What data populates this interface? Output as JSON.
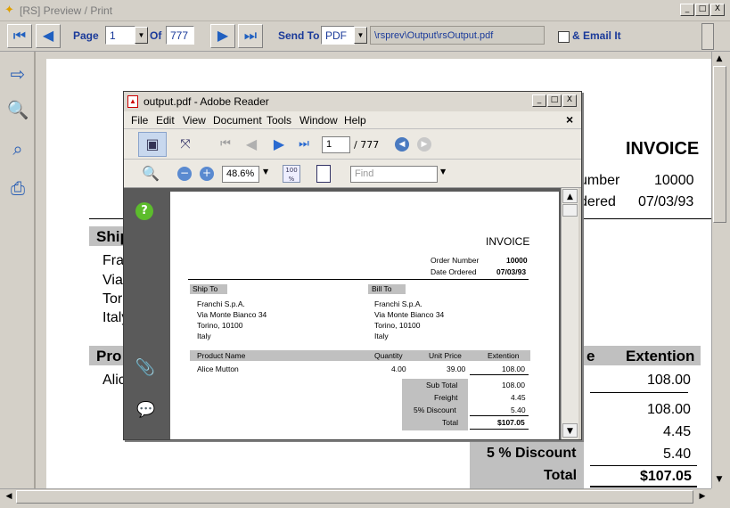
{
  "main_window": {
    "title": "[RS] Preview  / Print",
    "controls": {
      "minimize": "_",
      "maximize": "□",
      "close": "X"
    }
  },
  "toolbar": {
    "first_icon": "first-page-icon",
    "prev_icon": "prev-page-icon",
    "page_label": "Page",
    "page_value": "1",
    "of_label": "Of",
    "total_pages": "777",
    "next_icon": "next-page-icon",
    "last_icon": "last-page-icon",
    "send_to_label": "Send To",
    "send_to_value": "PDF",
    "output_path": "\\rsprev\\Output\\rsOutput.pdf",
    "email_label": "& Email It",
    "email_checked": false
  },
  "side_tools": [
    "export-icon",
    "zoom-icon",
    "find-page-icon",
    "print-icon"
  ],
  "background_invoice": {
    "title": "INVOICE",
    "order_number_label": "umber",
    "order_number": "10000",
    "date_ordered_label": "dered",
    "date_ordered": "07/03/93",
    "ship_to_label": "Ship",
    "ship_lines": [
      "Fra",
      "Via",
      "Tor",
      "Italy"
    ],
    "product_label": "Pro",
    "product_first": "Alic",
    "price_label_partial": "e",
    "extention_label": "Extention",
    "line_amount": "108.00",
    "subtotal": "108.00",
    "freight": "4.45",
    "discount_label": "5  % Discount",
    "discount": "5.40",
    "total_label": "Total",
    "total": "$107.05"
  },
  "reader": {
    "title": "output.pdf - Adobe Reader",
    "menu": [
      "File",
      "Edit",
      "View",
      "Document",
      "Tools",
      "Window",
      "Help"
    ],
    "page_value": "1",
    "page_total": "/ 777",
    "zoom": "48.6%",
    "find_placeholder": "Find",
    "close_doc": "×"
  },
  "pdf_invoice": {
    "title": "INVOICE",
    "order_number_label": "Order Number",
    "order_number": "10000",
    "date_ordered_label": "Date Ordered",
    "date_ordered": "07/03/93",
    "ship_to_label": "Ship To",
    "bill_to_label": "Bill To",
    "ship_lines": [
      "Franchi S.p.A.",
      "Via Monte Bianco 34",
      "Torino,  10100",
      "Italy"
    ],
    "bill_lines": [
      "Franchi S.p.A.",
      "Via Monte Bianco 34",
      "Torino,  10100",
      "Italy"
    ],
    "columns": [
      "Product Name",
      "Quantity",
      "Unit Price",
      "Extention"
    ],
    "row": {
      "product": "Alice Mutton",
      "quantity": "4.00",
      "unit_price": "39.00",
      "extention": "108.00"
    },
    "subtotal_label": "Sub Total",
    "subtotal": "108.00",
    "freight_label": "Freight",
    "freight": "4.45",
    "discount_label": "5% Discount",
    "discount": "5.40",
    "total_label": "Total",
    "total": "$107.05"
  }
}
